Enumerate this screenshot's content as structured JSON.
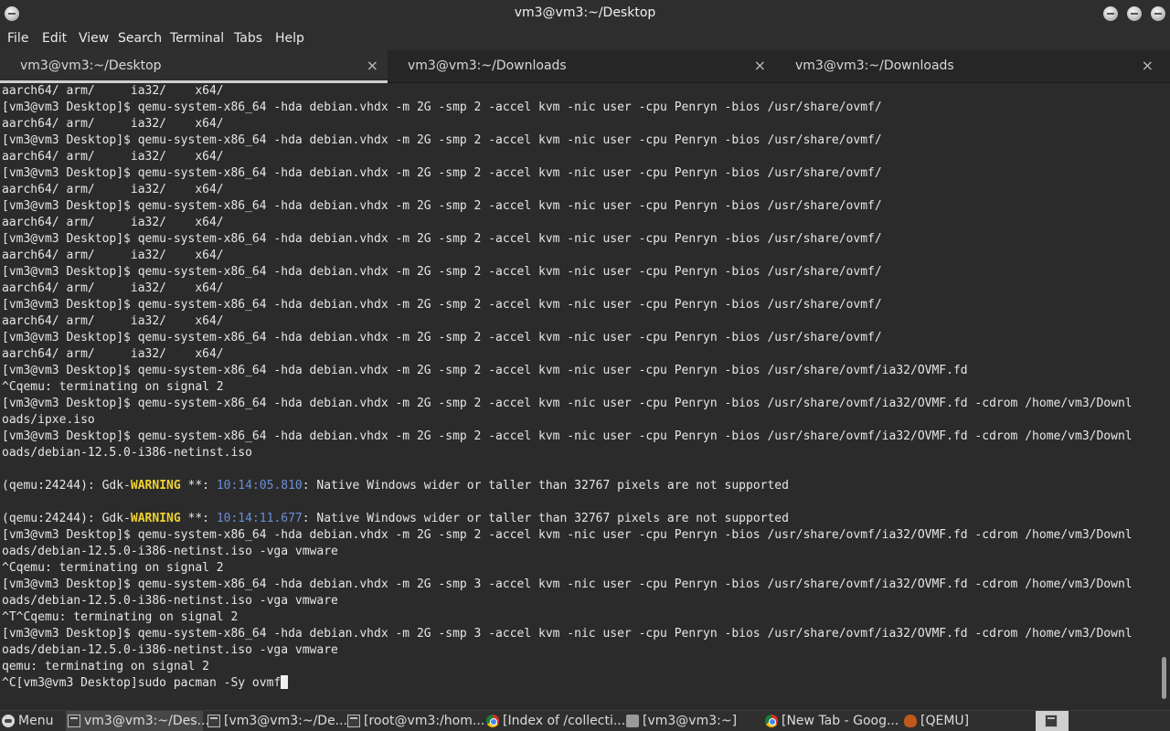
{
  "window": {
    "title": "vm3@vm3:~/Desktop"
  },
  "menu": [
    "File",
    "Edit",
    "View",
    "Search",
    "Terminal",
    "Tabs",
    "Help"
  ],
  "tabs": [
    {
      "label": "vm3@vm3:~/Desktop",
      "close": "×"
    },
    {
      "label": "vm3@vm3:~/Downloads",
      "close": "×"
    },
    {
      "label": "vm3@vm3:~/Downloads",
      "close": "×"
    }
  ],
  "terminal": {
    "lines": [
      "aarch64/ arm/     ia32/    x64/",
      "[vm3@vm3 Desktop]$ qemu-system-x86_64 -hda debian.vhdx -m 2G -smp 2 -accel kvm -nic user -cpu Penryn -bios /usr/share/ovmf/",
      "aarch64/ arm/     ia32/    x64/",
      "[vm3@vm3 Desktop]$ qemu-system-x86_64 -hda debian.vhdx -m 2G -smp 2 -accel kvm -nic user -cpu Penryn -bios /usr/share/ovmf/",
      "aarch64/ arm/     ia32/    x64/",
      "[vm3@vm3 Desktop]$ qemu-system-x86_64 -hda debian.vhdx -m 2G -smp 2 -accel kvm -nic user -cpu Penryn -bios /usr/share/ovmf/",
      "aarch64/ arm/     ia32/    x64/",
      "[vm3@vm3 Desktop]$ qemu-system-x86_64 -hda debian.vhdx -m 2G -smp 2 -accel kvm -nic user -cpu Penryn -bios /usr/share/ovmf/",
      "aarch64/ arm/     ia32/    x64/",
      "[vm3@vm3 Desktop]$ qemu-system-x86_64 -hda debian.vhdx -m 2G -smp 2 -accel kvm -nic user -cpu Penryn -bios /usr/share/ovmf/",
      "aarch64/ arm/     ia32/    x64/",
      "[vm3@vm3 Desktop]$ qemu-system-x86_64 -hda debian.vhdx -m 2G -smp 2 -accel kvm -nic user -cpu Penryn -bios /usr/share/ovmf/",
      "aarch64/ arm/     ia32/    x64/",
      "[vm3@vm3 Desktop]$ qemu-system-x86_64 -hda debian.vhdx -m 2G -smp 2 -accel kvm -nic user -cpu Penryn -bios /usr/share/ovmf/",
      "aarch64/ arm/     ia32/    x64/",
      "[vm3@vm3 Desktop]$ qemu-system-x86_64 -hda debian.vhdx -m 2G -smp 2 -accel kvm -nic user -cpu Penryn -bios /usr/share/ovmf/",
      "aarch64/ arm/     ia32/    x64/",
      "[vm3@vm3 Desktop]$ qemu-system-x86_64 -hda debian.vhdx -m 2G -smp 2 -accel kvm -nic user -cpu Penryn -bios /usr/share/ovmf/ia32/OVMF.fd",
      "^Cqemu: terminating on signal 2",
      "[vm3@vm3 Desktop]$ qemu-system-x86_64 -hda debian.vhdx -m 2G -smp 2 -accel kvm -nic user -cpu Penryn -bios /usr/share/ovmf/ia32/OVMF.fd -cdrom /home/vm3/Downl",
      "oads/ipxe.iso",
      "[vm3@vm3 Desktop]$ qemu-system-x86_64 -hda debian.vhdx -m 2G -smp 2 -accel kvm -nic user -cpu Penryn -bios /usr/share/ovmf/ia32/OVMF.fd -cdrom /home/vm3/Downl",
      "oads/debian-12.5.0-i386-netinst.iso",
      "",
      [
        {
          "t": "(qemu:24244): Gdk-"
        },
        {
          "t": "WARNING",
          "c": "warn"
        },
        {
          "t": " **: "
        },
        {
          "t": "10:14:05.810",
          "c": "time"
        },
        {
          "t": ": Native Windows wider or taller than 32767 pixels are not supported"
        }
      ],
      "",
      [
        {
          "t": "(qemu:24244): Gdk-"
        },
        {
          "t": "WARNING",
          "c": "warn"
        },
        {
          "t": " **: "
        },
        {
          "t": "10:14:11.677",
          "c": "time"
        },
        {
          "t": ": Native Windows wider or taller than 32767 pixels are not supported"
        }
      ],
      "[vm3@vm3 Desktop]$ qemu-system-x86_64 -hda debian.vhdx -m 2G -smp 2 -accel kvm -nic user -cpu Penryn -bios /usr/share/ovmf/ia32/OVMF.fd -cdrom /home/vm3/Downl",
      "oads/debian-12.5.0-i386-netinst.iso -vga vmware",
      "^Cqemu: terminating on signal 2",
      "[vm3@vm3 Desktop]$ qemu-system-x86_64 -hda debian.vhdx -m 2G -smp 3 -accel kvm -nic user -cpu Penryn -bios /usr/share/ovmf/ia32/OVMF.fd -cdrom /home/vm3/Downl",
      "oads/debian-12.5.0-i386-netinst.iso -vga vmware",
      "^T^Cqemu: terminating on signal 2",
      "[vm3@vm3 Desktop]$ qemu-system-x86_64 -hda debian.vhdx -m 2G -smp 3 -accel kvm -nic user -cpu Penryn -bios /usr/share/ovmf/ia32/OVMF.fd -cdrom /home/vm3/Downl",
      "oads/debian-12.5.0-i386-netinst.iso -vga vmware",
      "qemu: terminating on signal 2",
      "^C[vm3@vm3 Desktop]sudo pacman -Sy ovmf"
    ],
    "warning_color": "#f0d230",
    "time_color": "#6a8fd6"
  },
  "taskbar": {
    "menu_label": "Menu",
    "items": [
      {
        "label": "vm3@vm3:~/Des...",
        "icon": "terminal-icon",
        "active": true
      },
      {
        "label": "[vm3@vm3:~/De...",
        "icon": "terminal-icon"
      },
      {
        "label": "[root@vm3:/hom...",
        "icon": "terminal-icon"
      },
      {
        "label": "[Index of /collecti...",
        "icon": "chrome-icon"
      },
      {
        "label": "[vm3@vm3:~]",
        "icon": "folder-icon"
      },
      {
        "label": "[New Tab - Goog...",
        "icon": "chrome-icon"
      },
      {
        "label": "[QEMU]",
        "icon": "qemu-icon"
      }
    ]
  }
}
